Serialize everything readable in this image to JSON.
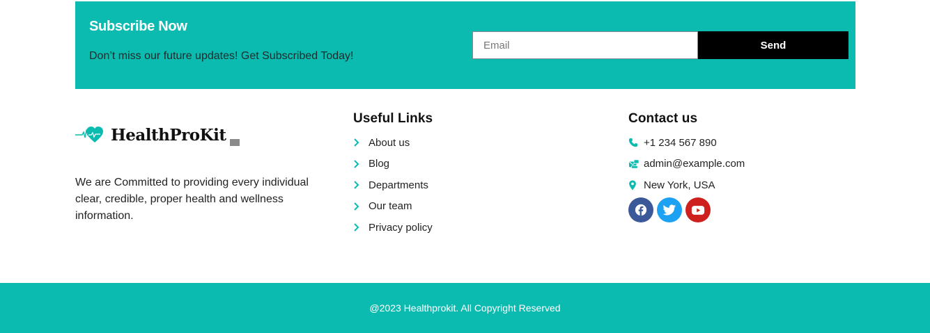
{
  "subscribe": {
    "title": "Subscribe Now",
    "description": "Don’t miss our future updates! Get Subscribed Today!",
    "email_placeholder": "Email",
    "send_label": "Send",
    "background_color": "#0bbbb0"
  },
  "brand": {
    "logo_text": "HealthProKit",
    "logo_icon": "heart-pulse-icon",
    "about": "We are Committed to providing every individual clear, credible, proper health and wellness information."
  },
  "useful_links": {
    "heading": "Useful Links",
    "items": [
      {
        "label": "About us",
        "icon": "chevron-right-icon"
      },
      {
        "label": "Blog",
        "icon": "chevron-right-icon"
      },
      {
        "label": "Departments",
        "icon": "chevron-right-icon"
      },
      {
        "label": "Our team",
        "icon": "chevron-right-icon"
      },
      {
        "label": "Privacy policy",
        "icon": "chevron-right-icon"
      }
    ]
  },
  "contact": {
    "heading": "Contact us",
    "items": [
      {
        "label": "+1 234 567 890",
        "icon": "phone-icon"
      },
      {
        "label": "admin@example.com",
        "icon": "mail-icon"
      },
      {
        "label": "New York, USA",
        "icon": "map-pin-icon"
      }
    ],
    "socials": [
      {
        "name": "facebook",
        "icon": "facebook-icon",
        "color": "#3b5998"
      },
      {
        "name": "twitter",
        "icon": "twitter-icon",
        "color": "#1da1f2"
      },
      {
        "name": "youtube",
        "icon": "youtube-icon",
        "color": "#cd201f"
      }
    ]
  },
  "footer": {
    "copyright": "@2023 Healthprokit. All Copyright Reserved"
  },
  "colors": {
    "accent": "#0bbbb0",
    "button": "#000000"
  }
}
